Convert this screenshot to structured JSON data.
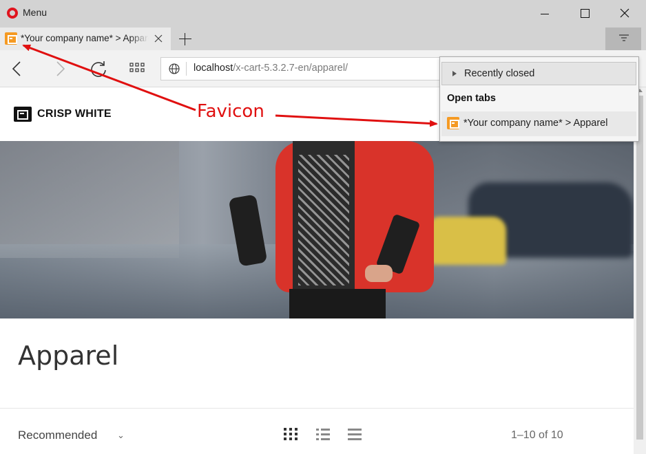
{
  "window": {
    "menu_label": "Menu"
  },
  "tab": {
    "title": "*Your company name* > Apparel"
  },
  "address": {
    "host": "localhost",
    "path": "/x-cart-5.3.2.7-en/apparel/"
  },
  "store": {
    "name": "CRISP WHITE"
  },
  "page": {
    "category_title": "Apparel",
    "sort_label": "Recommended",
    "sort_caret": "⌄",
    "count_label": "1–10 of 10"
  },
  "tab_menu": {
    "recently_closed_label": "Recently closed",
    "open_tabs_label": "Open tabs",
    "open_tab_title": "*Your company name* > Apparel"
  },
  "annotation": {
    "label": "Favicon",
    "color": "#e01010"
  },
  "colors": {
    "favicon": "#f59a23",
    "opera_red": "#e0141e"
  }
}
